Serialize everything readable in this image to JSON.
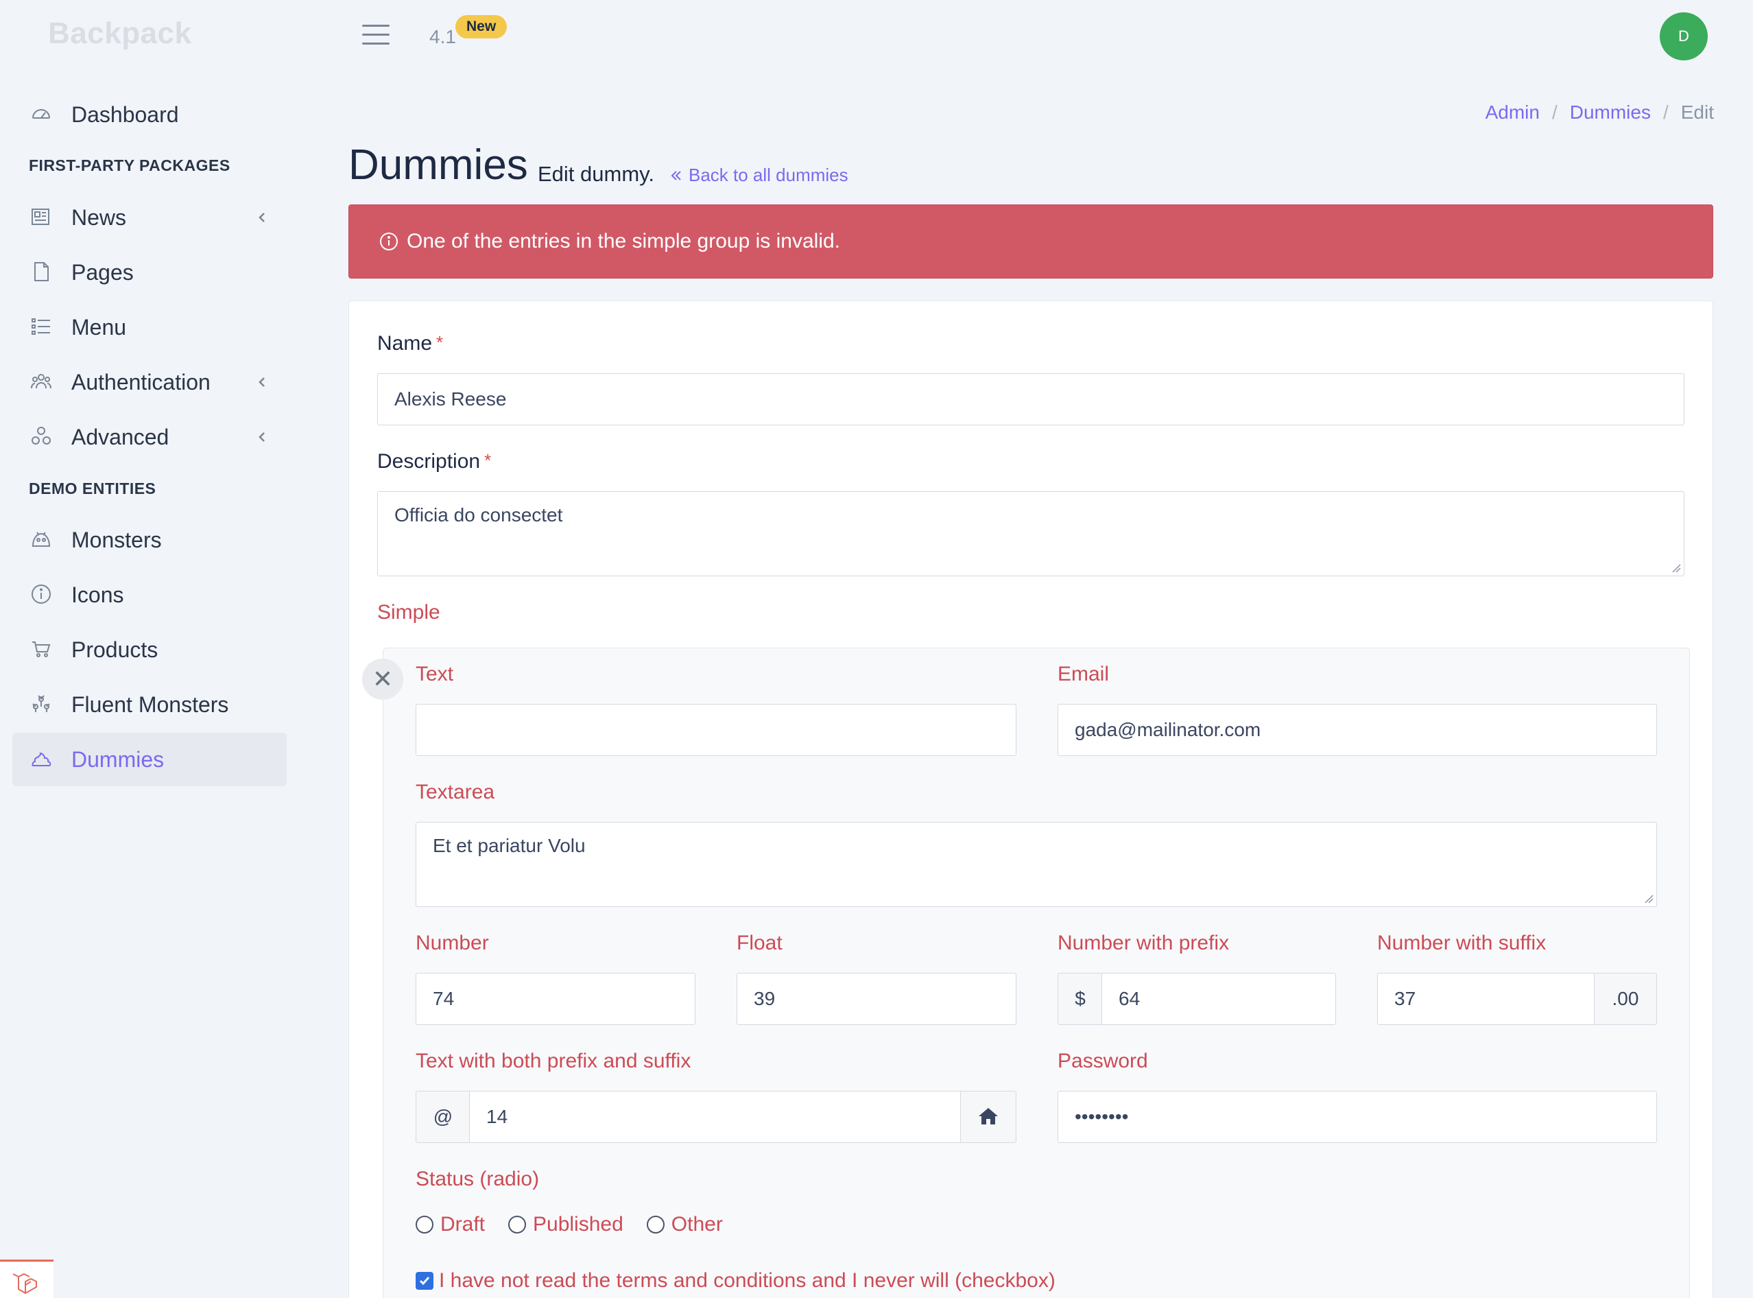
{
  "brand": "Backpack",
  "header": {
    "version": "4.1",
    "new_badge": "New",
    "avatar_initial": "D"
  },
  "sidebar": {
    "dashboard": "Dashboard",
    "section1": "FIRST-PARTY PACKAGES",
    "news": "News",
    "pages": "Pages",
    "menu": "Menu",
    "authentication": "Authentication",
    "advanced": "Advanced",
    "section2": "DEMO ENTITIES",
    "monsters": "Monsters",
    "icons": "Icons",
    "products": "Products",
    "fluent_monsters": "Fluent Monsters",
    "dummies": "Dummies"
  },
  "breadcrumb": {
    "admin": "Admin",
    "sep": "/",
    "dummies": "Dummies",
    "current": "Edit"
  },
  "page": {
    "title": "Dummies",
    "subtitle": "Edit dummy.",
    "back_link": "Back to all dummies"
  },
  "alert": {
    "message": "One of the entries in the simple group is invalid."
  },
  "form": {
    "name_label": "Name",
    "name_value": "Alexis Reese",
    "required_mark": "*",
    "description_label": "Description",
    "description_value": "Officia do consectet",
    "simple_label": "Simple",
    "remove_symbol": "✕",
    "text_label": "Text",
    "text_value": "",
    "email_label": "Email",
    "email_value": "gada@mailinator.com",
    "textarea_label": "Textarea",
    "textarea_value": "Et et pariatur Volu",
    "number_label": "Number",
    "number_value": "74",
    "float_label": "Float",
    "float_value": "39",
    "number_prefix_label": "Number with prefix",
    "number_prefix_addon": "$",
    "number_prefix_value": "64",
    "number_suffix_label": "Number with suffix",
    "number_suffix_value": "37",
    "number_suffix_addon": ".00",
    "text_both_label": "Text with both prefix and suffix",
    "text_both_prefix": "@",
    "text_both_value": "14",
    "password_label": "Password",
    "password_value": "••••••••",
    "status_label": "Status (radio)",
    "status_options": [
      "Draft",
      "Published",
      "Other"
    ],
    "checkbox_label": "I have not read the terms and conditions and I never will (checkbox)"
  },
  "colors": {
    "accent": "#7c69ef",
    "error": "#cc4b55",
    "alert_bg": "#d15966",
    "badge": "#f4c84b",
    "avatar": "#3bab5c"
  }
}
